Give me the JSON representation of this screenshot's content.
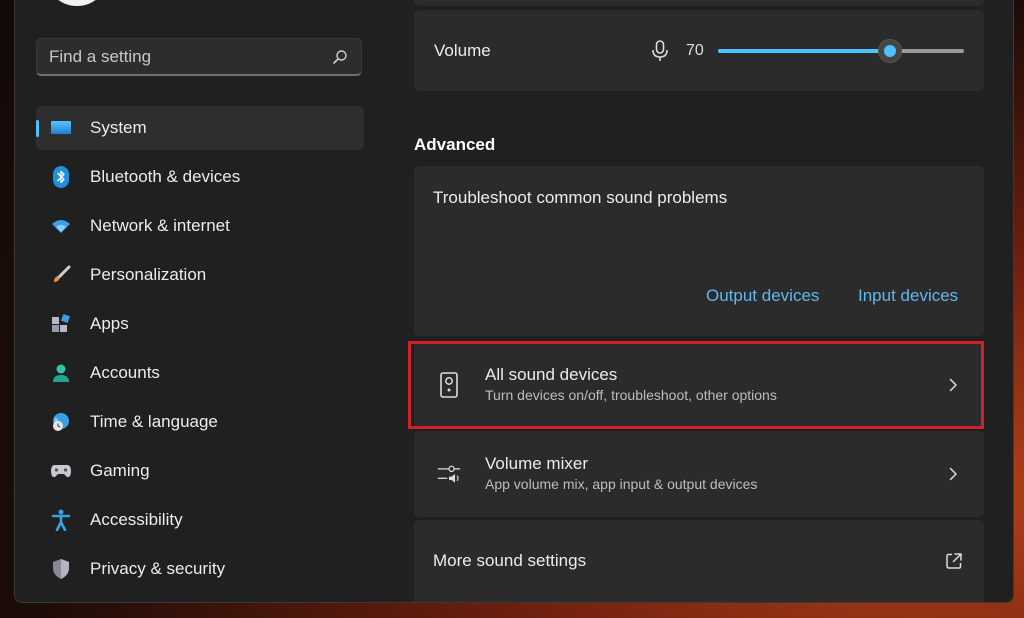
{
  "sidebar": {
    "search_placeholder": "Find a setting",
    "items": [
      {
        "label": "System",
        "icon": "monitor-icon",
        "active": true
      },
      {
        "label": "Bluetooth & devices",
        "icon": "bluetooth-icon"
      },
      {
        "label": "Network & internet",
        "icon": "wifi-icon"
      },
      {
        "label": "Personalization",
        "icon": "brush-icon"
      },
      {
        "label": "Apps",
        "icon": "apps-icon"
      },
      {
        "label": "Accounts",
        "icon": "person-icon"
      },
      {
        "label": "Time & language",
        "icon": "globe-clock-icon"
      },
      {
        "label": "Gaming",
        "icon": "gamepad-icon"
      },
      {
        "label": "Accessibility",
        "icon": "accessibility-icon"
      },
      {
        "label": "Privacy & security",
        "icon": "shield-icon"
      }
    ]
  },
  "volume": {
    "label": "Volume",
    "value": "70",
    "level_percent": 70
  },
  "advanced": {
    "heading": "Advanced",
    "troubleshoot": {
      "title": "Troubleshoot common sound problems",
      "output_link": "Output devices",
      "input_link": "Input devices"
    },
    "all_sound_devices": {
      "title": "All sound devices",
      "subtitle": "Turn devices on/off, troubleshoot, other options"
    },
    "volume_mixer": {
      "title": "Volume mixer",
      "subtitle": "App volume mix, app input & output devices"
    },
    "more_sound_settings": {
      "title": "More sound settings"
    }
  },
  "colors": {
    "accent": "#4cc2ff",
    "link": "#60b8f0",
    "highlight": "#d1212b",
    "window_bg": "#202020",
    "card_bg": "#2b2b2b"
  }
}
